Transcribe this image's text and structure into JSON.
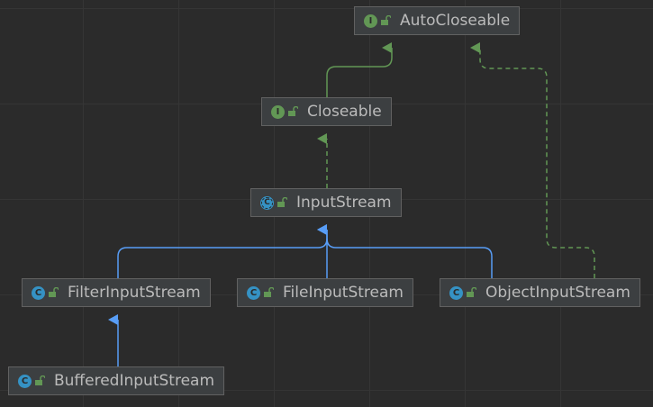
{
  "diagram": {
    "nodes": [
      {
        "id": "autocloseable",
        "name": "AutoCloseable",
        "kind": "interface",
        "badge": "I",
        "icon": "interface-icon"
      },
      {
        "id": "closeable",
        "name": "Closeable",
        "kind": "interface",
        "badge": "I",
        "icon": "interface-icon"
      },
      {
        "id": "inputstream",
        "name": "InputStream",
        "kind": "abstract-class",
        "badge": "C",
        "icon": "abstract-class-icon"
      },
      {
        "id": "filterinputstream",
        "name": "FilterInputStream",
        "kind": "class",
        "badge": "C",
        "icon": "class-icon"
      },
      {
        "id": "fileinputstream",
        "name": "FileInputStream",
        "kind": "class",
        "badge": "C",
        "icon": "class-icon"
      },
      {
        "id": "objectinputstream",
        "name": "ObjectInputStream",
        "kind": "class",
        "badge": "C",
        "icon": "class-icon"
      },
      {
        "id": "bufferedinputstream",
        "name": "BufferedInputStream",
        "kind": "class",
        "badge": "C",
        "icon": "class-icon"
      }
    ],
    "edges": [
      {
        "from": "closeable",
        "to": "autocloseable",
        "type": "extends-interface"
      },
      {
        "from": "inputstream",
        "to": "closeable",
        "type": "implements"
      },
      {
        "from": "filterinputstream",
        "to": "inputstream",
        "type": "extends"
      },
      {
        "from": "fileinputstream",
        "to": "inputstream",
        "type": "extends"
      },
      {
        "from": "objectinputstream",
        "to": "inputstream",
        "type": "extends"
      },
      {
        "from": "objectinputstream",
        "to": "autocloseable",
        "type": "implements"
      },
      {
        "from": "bufferedinputstream",
        "to": "filterinputstream",
        "type": "extends"
      }
    ],
    "colors": {
      "background": "#2b2b2b",
      "node_fill": "#3c3f41",
      "node_border": "#616161",
      "text": "#bbbbbb",
      "interface_edge": "#629755",
      "class_edge": "#589df6",
      "interface_badge": "#629755",
      "class_badge": "#3592c4",
      "lock": "#629755"
    }
  }
}
